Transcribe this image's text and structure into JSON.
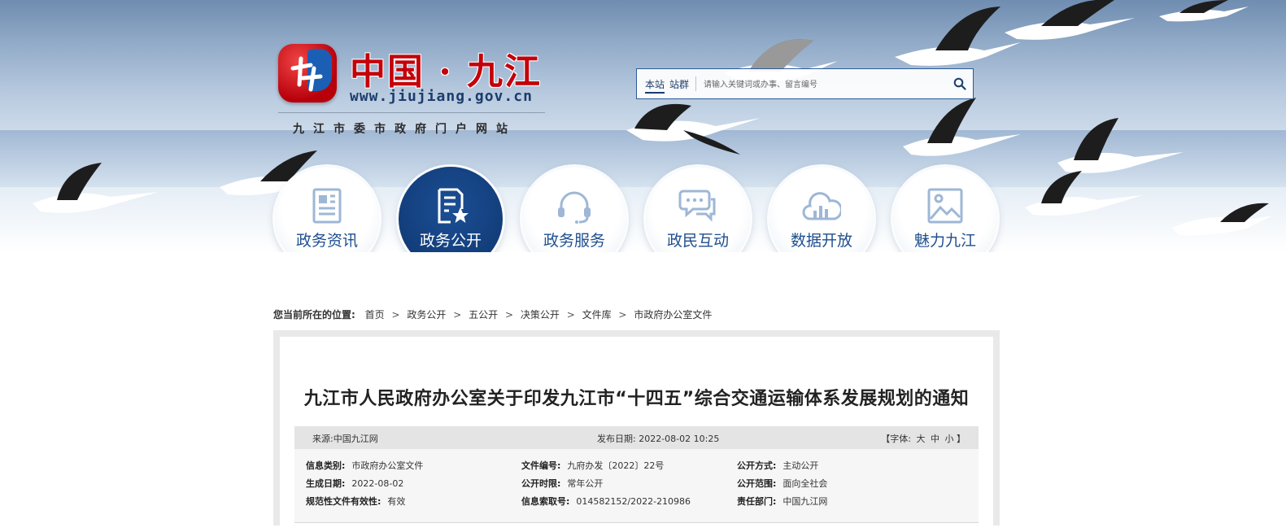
{
  "logo": {
    "title": "中国 · 九江",
    "url": "www.jiujiang.gov.cn",
    "subtitle": "九江市委市政府门户网站"
  },
  "search": {
    "tab_site": "本站",
    "tab_group": "站群",
    "placeholder": "请输入关键词或办事、留言编号"
  },
  "nav": [
    {
      "label": "政务资讯",
      "icon": "newspaper-icon"
    },
    {
      "label": "政务公开",
      "icon": "document-star-icon",
      "active": true
    },
    {
      "label": "政务服务",
      "icon": "headset-icon"
    },
    {
      "label": "政民互动",
      "icon": "chat-bubbles-icon"
    },
    {
      "label": "数据开放",
      "icon": "cloud-chart-icon"
    },
    {
      "label": "魅力九江",
      "icon": "picture-icon"
    }
  ],
  "breadcrumb": {
    "label": "您当前所在的位置:",
    "items": [
      "首页",
      "政务公开",
      "五公开",
      "决策公开",
      "文件库",
      "市政府办公室文件"
    ]
  },
  "article": {
    "title": "九江市人民政府办公室关于印发九江市“十四五”综合交通运输体系发展规划的通知",
    "source": "来源:中国九江网",
    "publish_date": "发布日期: 2022-08-02 10:25",
    "font_size": {
      "prefix": "【字体:",
      "large": "大",
      "medium": "中",
      "small": "小",
      "suffix": "】"
    }
  },
  "info": {
    "category": {
      "key": "信息类别:",
      "value": "市政府办公室文件"
    },
    "doc_no": {
      "key": "文件编号:",
      "value": "九府办发〔2022〕22号"
    },
    "open_method": {
      "key": "公开方式:",
      "value": "主动公开"
    },
    "created": {
      "key": "生成日期:",
      "value": "2022-08-02"
    },
    "open_period": {
      "key": "公开时限:",
      "value": "常年公开"
    },
    "open_scope": {
      "key": "公开范围:",
      "value": "面向全社会"
    },
    "validity": {
      "key": "规范性文件有效性:",
      "value": "有效"
    },
    "index_no": {
      "key": "信息索取号:",
      "value": "014582152/2022-210986"
    },
    "department": {
      "key": "责任部门:",
      "value": "中国九江网"
    }
  },
  "colors": {
    "brand_red": "#c4000a",
    "brand_blue": "#123d7a",
    "nav_text": "#1e4f8f"
  }
}
